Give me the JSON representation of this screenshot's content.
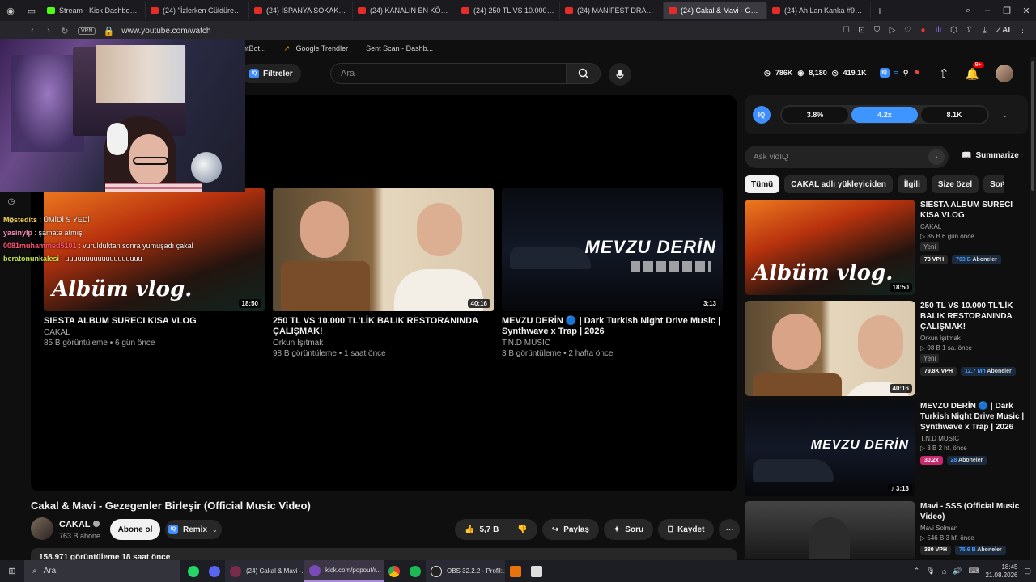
{
  "browser": {
    "tabs": [
      {
        "label": "Stream - Kick Dashboard",
        "kind": "kick",
        "active": false
      },
      {
        "label": "(24) ''İzlerken Güldüren Ed",
        "kind": "yt",
        "active": false
      },
      {
        "label": "(24) İSPANYA SOKAK YEM",
        "kind": "yt",
        "active": false
      },
      {
        "label": "(24) KANALIN EN KÖTÜ VİD",
        "kind": "yt",
        "active": false
      },
      {
        "label": "(24) 250 TL VS 10.000 TL'L",
        "kind": "yt",
        "active": false
      },
      {
        "label": "(24) MANİFEST DRAMASI",
        "kind": "yt",
        "active": false
      },
      {
        "label": "(24) Cakal & Mavi - Gezeg",
        "kind": "yt",
        "active": true
      },
      {
        "label": "(24) Ah Lan Kanka #94 | Bi",
        "kind": "yt",
        "active": false
      }
    ],
    "new_tab": "+",
    "vpn": "VPN",
    "url": "www.youtube.com/watch",
    "ai_label": "AI",
    "bookmarks": [
      "ntBot...",
      "Google Trendler",
      "Sent Scan - Dashb..."
    ]
  },
  "chat": [
    {
      "user": "Mostedits",
      "sep": " : ",
      "msg": "ÜMİDİ S YEDİ",
      "cls": "c2"
    },
    {
      "user": "yasinylp",
      "sep": " : ",
      "msg": "şamata atmış",
      "cls": "c1"
    },
    {
      "user": "0081muhammed5101",
      "sep": " : ",
      "msg": "vurulduktan sonra yumuşadı çakal",
      "cls": "c3"
    },
    {
      "user": "beratonunkalesi",
      "sep": " : ",
      "msg": "uuuuuuuuuuuuuuuuuuu",
      "cls": "c4"
    }
  ],
  "youtube": {
    "filters_label": "Filtreler",
    "search_placeholder": "Ara",
    "stats": {
      "views": "786K",
      "watching": "8,180",
      "total": "419.1K"
    },
    "notif_count": "9+",
    "end_cards": [
      {
        "title": "SIESTA ALBUM SURECI KISA VLOG",
        "channel": "CAKAL",
        "meta": "85 B görüntüleme • 6 gün önce",
        "duration": "18:50",
        "thumb_text": "Albüm vlog."
      },
      {
        "title": "250 TL VS 10.000 TL'LİK BALIK RESTORANINDA ÇALIŞMAK!",
        "channel": "Orkun Işıtmak",
        "meta": "98 B görüntüleme • 1 saat önce",
        "duration": "40:16"
      },
      {
        "title": "MEVZU DERİN 🔵 | Dark Turkish Night Drive Music | Synthwave x Trap | 2026",
        "channel": "T.N.D MUSIC",
        "meta": "3 B görüntüleme • 2 hafta önce",
        "duration": "3:13",
        "thumb_text": "MEVZU DERİN"
      }
    ],
    "video": {
      "title": "Cakal & Mavi - Gezegenler Birleşir (Official Music Video)",
      "channel": "CAKAL",
      "subs": "763 B abone",
      "subscribe": "Abone ol",
      "remix": "Remix",
      "likes": "5,7 B",
      "share": "Paylaş",
      "ask": "Soru",
      "save": "Kaydet",
      "desc": "158.971 görüntüleme  18 saat önce"
    },
    "vidiq": {
      "logo": "IQ",
      "metrics": [
        "3.8%",
        "4.2x",
        "8.1K"
      ],
      "ask_placeholder": "Ask vidIQ",
      "summarize": "Summarize"
    },
    "chips": [
      "Tümü",
      "CAKAL adlı yükleyiciden",
      "İlgili",
      "Size özel",
      "Son yük"
    ],
    "recommendations": [
      {
        "title": "SIESTA ALBUM SURECI KISA VLOG",
        "channel": "CAKAL",
        "meta": "▷ 85 B  6 gün önce",
        "badge": "Yeni",
        "vph": "73 VPH",
        "subs_num": "763 B",
        "subs_lbl": "Aboneler",
        "duration": "18:50",
        "thumb_text": "Albüm vlog."
      },
      {
        "title": "250 TL VS 10.000 TL'LİK BALIK RESTORANINDA ÇALIŞMAK!",
        "channel": "Orkun Işıtmak",
        "meta": "▷ 98 B  1 sa. önce",
        "badge": "Yeni",
        "vph": "79.8K VPH",
        "subs_num": "12.7 Mn",
        "subs_lbl": "Aboneler",
        "duration": "40:16"
      },
      {
        "title": "MEVZU DERİN 🔵 | Dark Turkish Night Drive Music | Synthwave x Trap | 2026",
        "channel": "T.N.D MUSIC",
        "meta": "▷ 3 B  2 hf. önce",
        "badge": "",
        "vph": "30.2x",
        "subs_num": "28",
        "subs_lbl": "Aboneler",
        "duration": "♪ 3:13",
        "thumb_text": "MEVZU DERİN"
      },
      {
        "title": "Mavi - SSS (Official Music Video)",
        "channel": "Mavi Solman",
        "meta": "▷ 546 B  3 hf. önce",
        "badge": "",
        "vph": "380 VPH",
        "subs_num": "75.6 B",
        "subs_lbl": "Aboneler"
      }
    ]
  },
  "taskbar": {
    "search": "Ara",
    "apps": [
      {
        "label": "(24) Cakal & Mavi -...",
        "color": "#7a2a4a",
        "sel": false
      },
      {
        "label": "kick.com/popout/r...",
        "color": "#7a4ab8",
        "sel": true
      },
      {
        "label": "OBS 32.2.2 - Profil:...",
        "color": "#222",
        "sel": false
      }
    ],
    "time": "18:45",
    "date": "21.08.2026"
  }
}
